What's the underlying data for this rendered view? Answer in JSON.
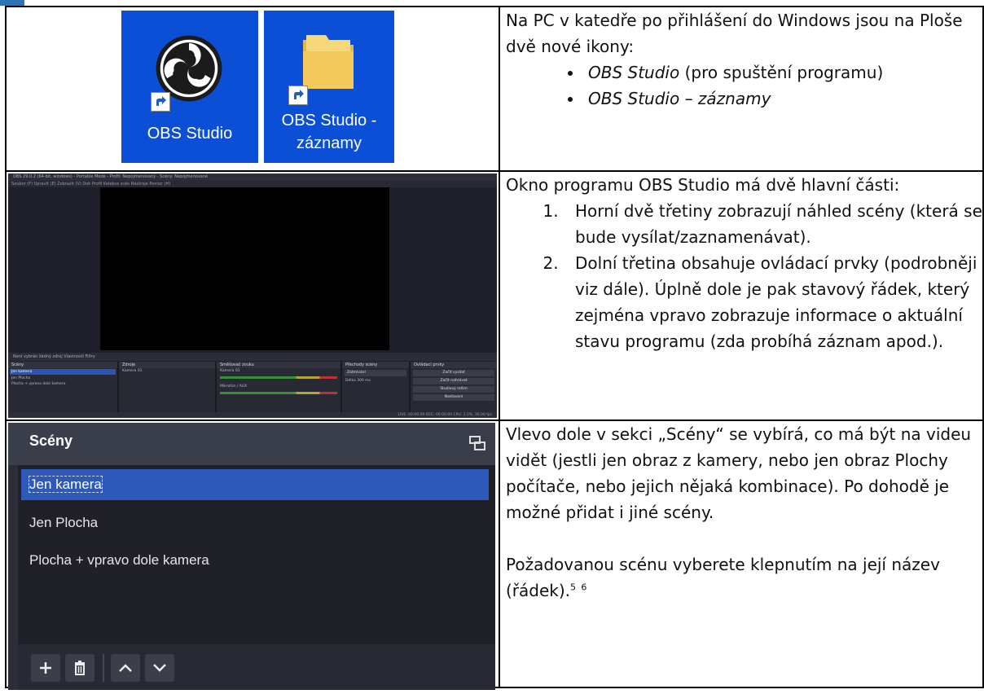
{
  "rows": [
    {
      "icons": [
        {
          "label": "OBS Studio",
          "icon": "obs-logo-icon"
        },
        {
          "label_line1": "OBS Studio -",
          "label_line2": "záznamy",
          "icon": "folder-icon"
        }
      ],
      "text": {
        "intro": "Na PC v katedře po přihlášení do Windows jsou na Ploše dvě nové ikony:",
        "bullets": [
          {
            "name": "OBS Studio",
            "rest": " (pro spuštění programu)"
          },
          {
            "name": "OBS Studio – záznamy",
            "rest": ""
          }
        ]
      }
    },
    {
      "obs": {
        "window_title": "OBS 29.0.2 (64-bit, windows) - Portable Mode - Profil: Nepojmenovaný - Scény: Nepojmenované",
        "menu": "Soubor (F)   Upravit (E)   Zobrazit (V)   Dok   Profil   Kolekce scén   Nástroje   Pomoc (H)",
        "strip": "Není vybrán žádný zdroj        Vlastnosti     Filtry",
        "docks": [
          "Scény",
          "Zdroje",
          "Směšovač zvuku",
          "Přechody scény",
          "Ovládací prvky"
        ],
        "scenes": [
          "Jen kamera",
          "Jen Plocha",
          "Plocha + vpravo dole kamera"
        ],
        "source": "Kamera 01",
        "mixer": [
          "Kamera 01",
          "Mikrofon / AUX"
        ],
        "transition": "Zatmívání",
        "duration_label": "Délka",
        "duration": "300 ms",
        "controls": [
          "Začít vysílat",
          "Začít nahrávat",
          "Studiový režim",
          "Nastavení",
          "Ukončit"
        ],
        "status": "LIVE: 00:00:00    REC: 00:00:00    CPU: 1.1%, 30.00 fps"
      },
      "text": {
        "intro": "Okno programu OBS Studio má dvě hlavní části:",
        "items": [
          "Horní dvě třetiny zobrazují náhled scény (která se bude vysílat/zaznamenávat).",
          "Dolní třetina obsahuje ovládací prvky (podrobněji viz dále). Úplně dole je pak stavový řádek, který zejména vpravo zobrazuje informace o aktuální stavu programu (zda probíhá záznam apod.)."
        ]
      }
    },
    {
      "panel": {
        "title": "Scény",
        "scenes": [
          "Jen kamera",
          "Jen Plocha",
          "Plocha + vpravo dole kamera"
        ],
        "selected_index": 0,
        "toolbar_icons": [
          "plus-icon",
          "trash-icon",
          "chevron-up-icon",
          "chevron-down-icon"
        ]
      },
      "text": {
        "para1": "Vlevo dole v sekci „Scény“ se vybírá, co má být na videu vidět (jestli jen obraz z kamery, nebo jen obraz Plochy počítače, nebo jejich nějaká kombinace). Po dohodě je možné přidat i jiné scény.",
        "para2": "Požadovanou scénu vyberete klepnutím na její název (řádek).",
        "footnote1": "5",
        "footnote2": "6"
      }
    }
  ]
}
